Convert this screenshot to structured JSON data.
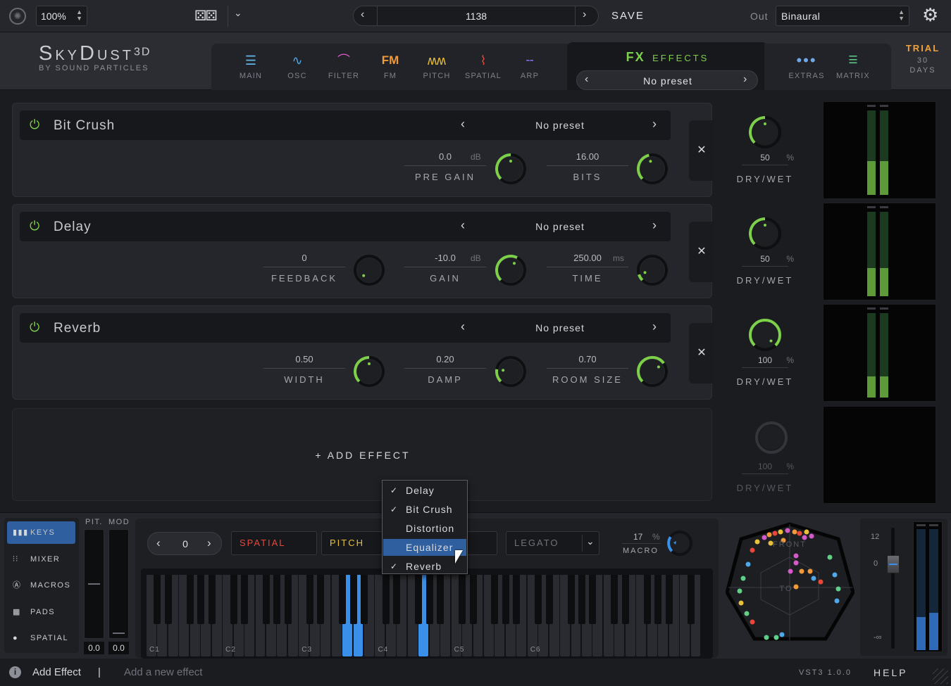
{
  "topbar": {
    "zoom": "100%",
    "patch_number": "1138",
    "save_label": "SAVE",
    "out_label": "Out",
    "out_value": "Binaural"
  },
  "brand": {
    "name": "SkyDust",
    "sup": "3D",
    "by": "BY SOUND PARTICLES"
  },
  "tabs": [
    {
      "label": "MAIN",
      "color": "#5fb8e8"
    },
    {
      "label": "OSC",
      "color": "#4fa8e8"
    },
    {
      "label": "FILTER",
      "color": "#d45ac8"
    },
    {
      "label": "FM",
      "color": "#f09a3a"
    },
    {
      "label": "PITCH",
      "color": "#e8c03a"
    },
    {
      "label": "SPATIAL",
      "color": "#e8473a"
    },
    {
      "label": "ARP",
      "color": "#8a6ae8"
    }
  ],
  "fx": {
    "title_a": "FX",
    "title_b": "EFFECTS",
    "preset": "No preset",
    "accent": "#7ed04b"
  },
  "extras_label": "EXTRAS",
  "matrix_label": "MATRIX",
  "trial": {
    "line1": "TRIAL",
    "line2": "30",
    "line3": "DAYS"
  },
  "effects": [
    {
      "name": "Bit Crush",
      "preset": "No preset",
      "dry_wet": "50",
      "dry_wet_unit": "%",
      "dry_wet_label": "DRY/WET",
      "dry_wet_fraction": 0.5,
      "params": [
        {
          "value": "0.0",
          "unit": "dB",
          "label": "PRE GAIN",
          "fraction": 0.5
        },
        {
          "value": "16.00",
          "unit": "",
          "label": "BITS",
          "fraction": 0.45
        }
      ]
    },
    {
      "name": "Delay",
      "preset": "No preset",
      "dry_wet": "50",
      "dry_wet_unit": "%",
      "dry_wet_label": "DRY/WET",
      "dry_wet_fraction": 0.5,
      "params": [
        {
          "value": "0",
          "unit": "",
          "label": "FEEDBACK",
          "fraction": 0.0
        },
        {
          "value": "-10.0",
          "unit": "dB",
          "label": "GAIN",
          "fraction": 0.6
        },
        {
          "value": "250.00",
          "unit": "ms",
          "label": "TIME",
          "fraction": 0.1
        }
      ]
    },
    {
      "name": "Reverb",
      "preset": "No preset",
      "dry_wet": "100",
      "dry_wet_unit": "%",
      "dry_wet_label": "DRY/WET",
      "dry_wet_fraction": 1.0,
      "params": [
        {
          "value": "0.50",
          "unit": "",
          "label": "WIDTH",
          "fraction": 0.5
        },
        {
          "value": "0.20",
          "unit": "",
          "label": "DAMP",
          "fraction": 0.2
        },
        {
          "value": "0.70",
          "unit": "",
          "label": "ROOM SIZE",
          "fraction": 0.7
        }
      ]
    }
  ],
  "empty_slot": {
    "dry_wet": "100",
    "dry_wet_unit": "%",
    "dry_wet_label": "DRY/WET"
  },
  "meters": [
    {
      "l": 0.4,
      "r": 0.4
    },
    {
      "l": 0.33,
      "r": 0.33
    },
    {
      "l": 0.25,
      "r": 0.25
    }
  ],
  "add_effect_label": "+ ADD EFFECT",
  "menu": [
    {
      "label": "Delay",
      "checked": true
    },
    {
      "label": "Bit Crush",
      "checked": true
    },
    {
      "label": "Distortion",
      "checked": false
    },
    {
      "label": "Equalizer",
      "checked": false,
      "highlighted": true
    },
    {
      "label": "Reverb",
      "checked": true
    }
  ],
  "side_nav": [
    {
      "label": "KEYS",
      "active": true
    },
    {
      "label": "MIXER"
    },
    {
      "label": "MACROS"
    },
    {
      "label": "PADS"
    },
    {
      "label": "SPATIAL"
    }
  ],
  "pitmod": {
    "pit_label": "PIT.",
    "mod_label": "MOD",
    "pit_value": "0.0",
    "mod_value": "0.0"
  },
  "keys_toolbar": {
    "octave": "0",
    "spatial": "SPATIAL",
    "pitch": "PITCH",
    "legato": "LEGATO",
    "macro_value": "17",
    "macro_unit": "%",
    "macro_label": "MACRO"
  },
  "octave_labels": [
    "C1",
    "C2",
    "C3",
    "C4",
    "C5",
    "C6"
  ],
  "spatial_view": {
    "front": "FRONT",
    "top": "TO"
  },
  "volume_scale": [
    "12",
    "0",
    "-∞"
  ],
  "status": {
    "title": "Add Effect",
    "sep": "|",
    "desc": "Add a new effect",
    "version": "VST3 1.0.0",
    "help": "HELP"
  }
}
